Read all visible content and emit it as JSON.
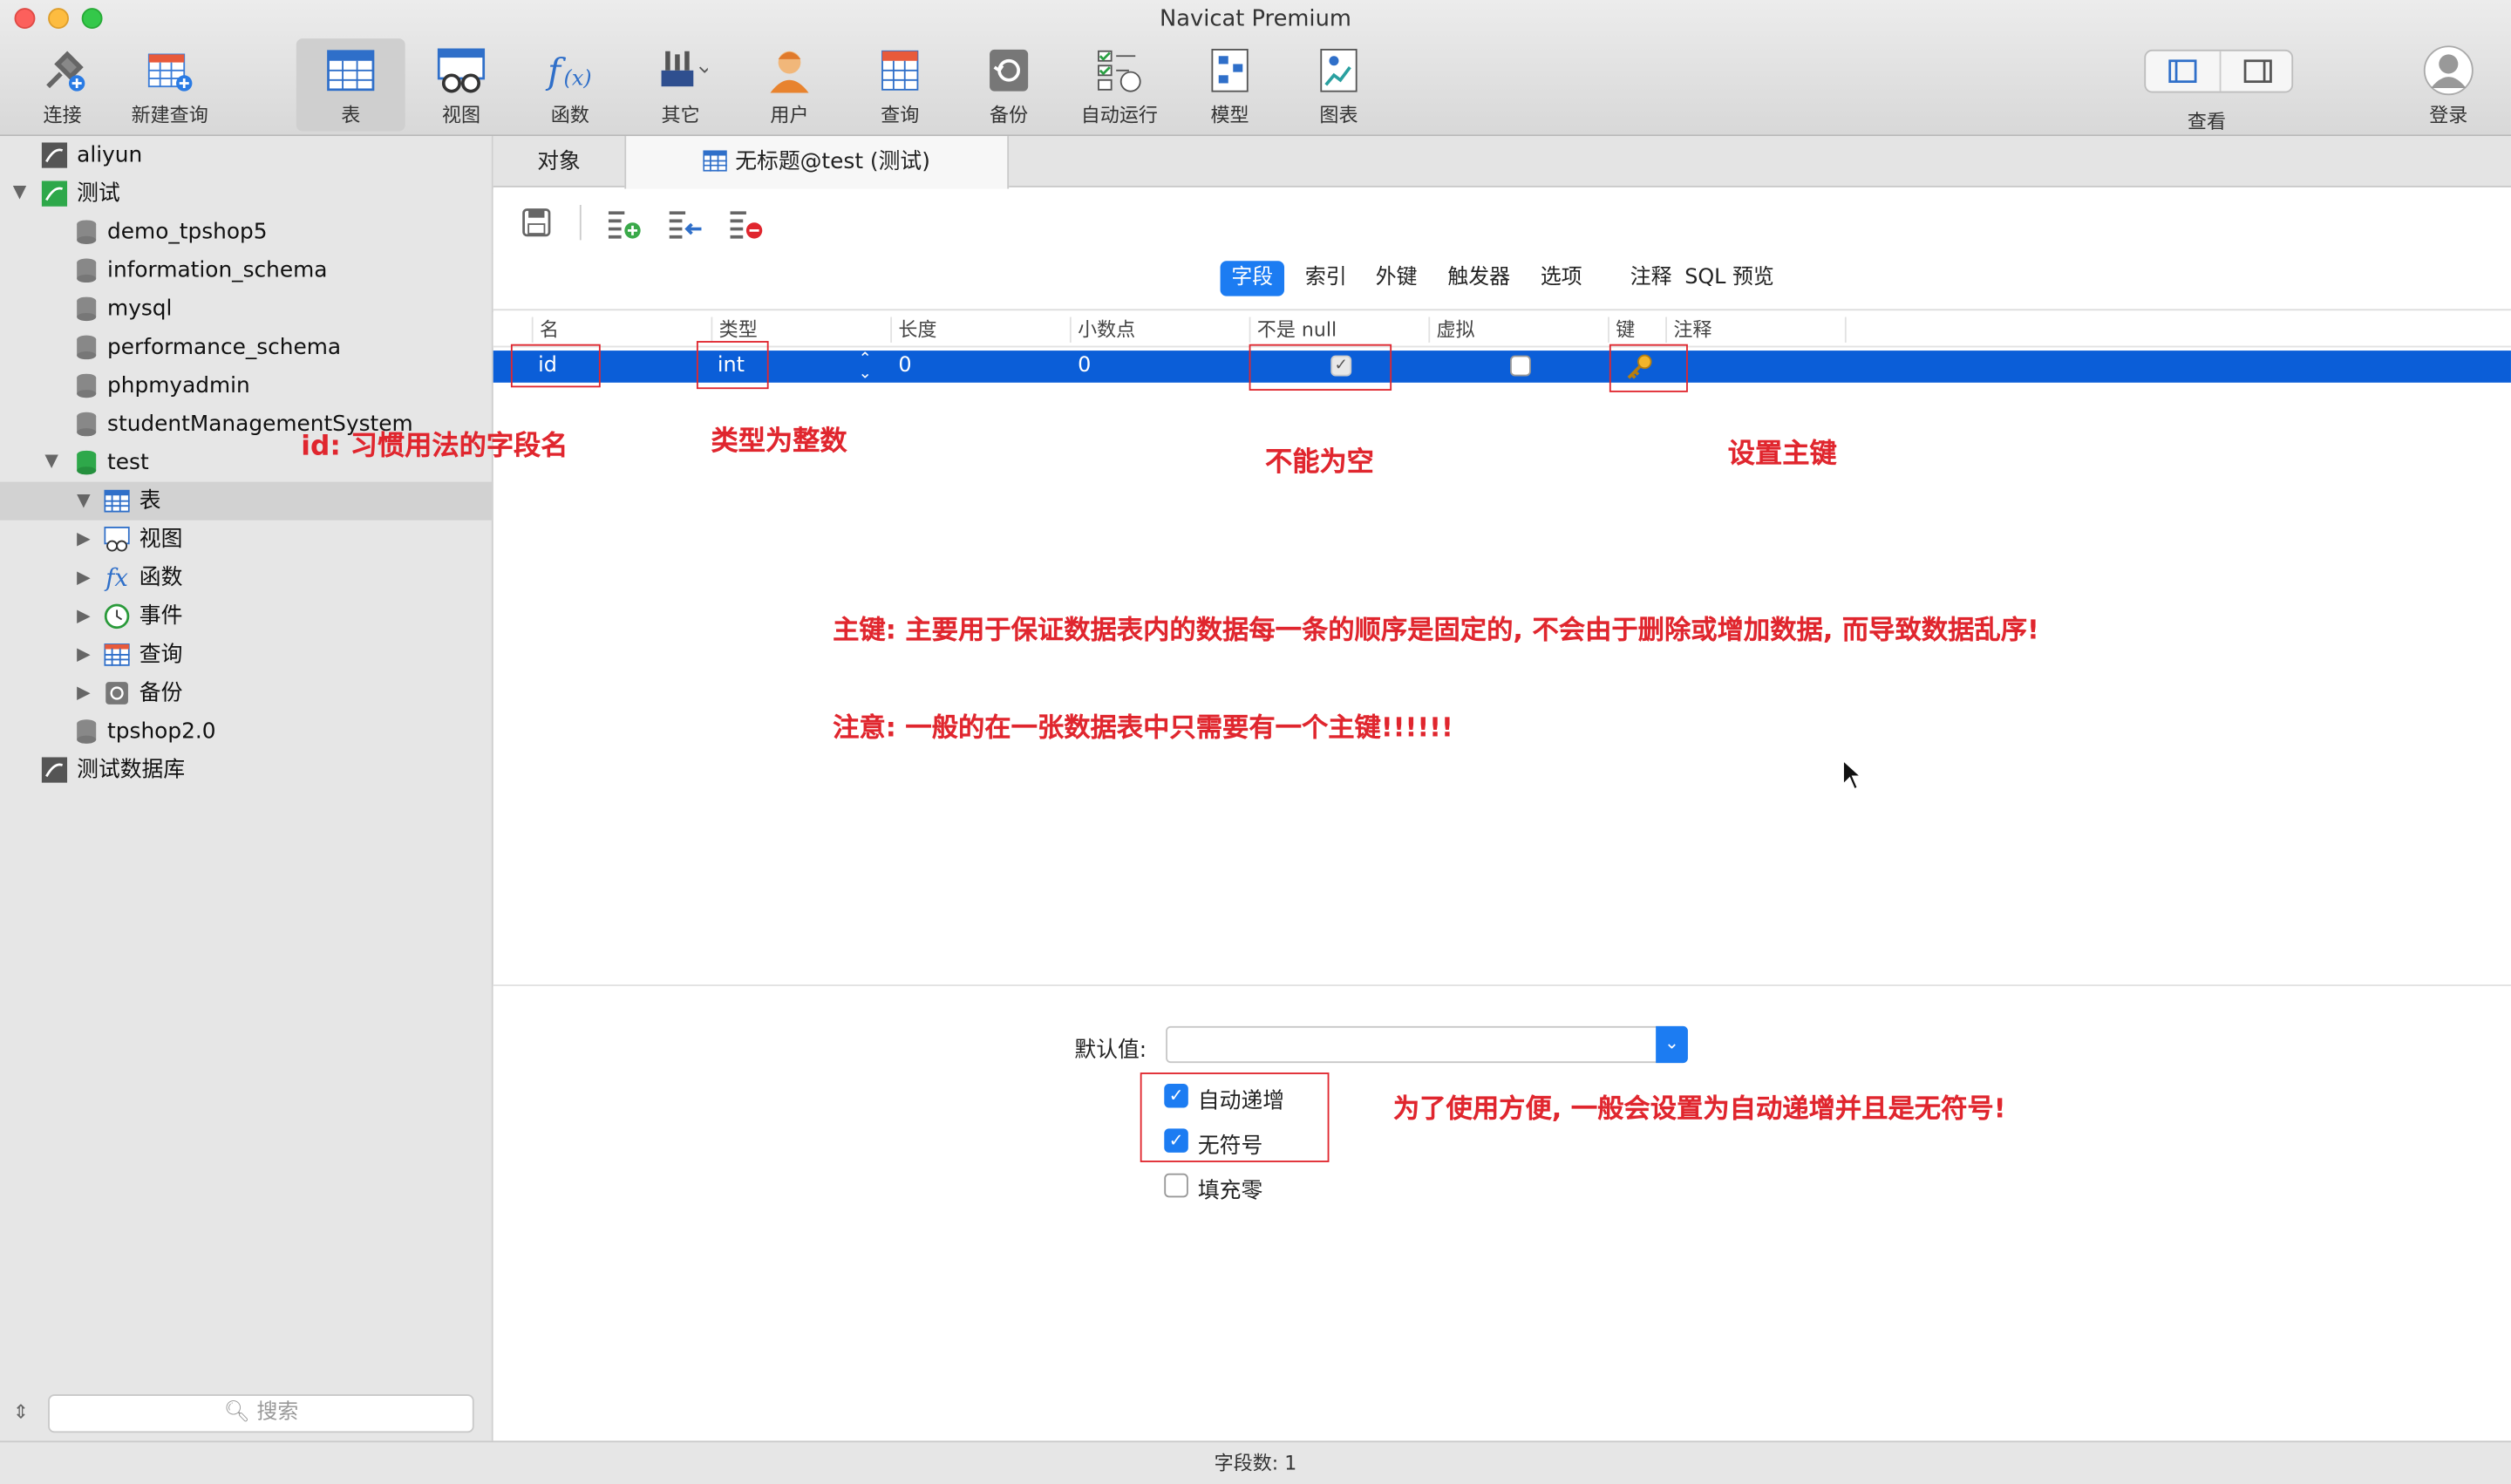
{
  "app_title": "Navicat Premium",
  "toolbar": {
    "items": [
      {
        "label": "连接"
      },
      {
        "label": "新建查询"
      },
      {
        "label": "表"
      },
      {
        "label": "视图"
      },
      {
        "label": "函数"
      },
      {
        "label": "其它"
      },
      {
        "label": "用户"
      },
      {
        "label": "查询"
      },
      {
        "label": "备份"
      },
      {
        "label": "自动运行"
      },
      {
        "label": "模型"
      },
      {
        "label": "图表"
      }
    ],
    "view_label": "查看",
    "login_label": "登录"
  },
  "sidebar": {
    "items": [
      {
        "label": "aliyun"
      },
      {
        "label": "测试"
      },
      {
        "label": "demo_tpshop5"
      },
      {
        "label": "information_schema"
      },
      {
        "label": "mysql"
      },
      {
        "label": "performance_schema"
      },
      {
        "label": "phpmyadmin"
      },
      {
        "label": "studentManagementSystem"
      },
      {
        "label": "test"
      },
      {
        "label": "表"
      },
      {
        "label": "视图"
      },
      {
        "label": "函数"
      },
      {
        "label": "事件"
      },
      {
        "label": "查询"
      },
      {
        "label": "备份"
      },
      {
        "label": "tpshop2.0"
      },
      {
        "label": "测试数据库"
      }
    ],
    "search_placeholder": "搜索"
  },
  "tabs": [
    {
      "label": "对象"
    },
    {
      "label": "无标题@test (测试)"
    }
  ],
  "subtabs": [
    {
      "label": "字段"
    },
    {
      "label": "索引"
    },
    {
      "label": "外键"
    },
    {
      "label": "触发器"
    },
    {
      "label": "选项"
    },
    {
      "label": "注释"
    },
    {
      "label": "SQL 预览"
    }
  ],
  "grid": {
    "headers": [
      "名",
      "类型",
      "长度",
      "小数点",
      "不是 null",
      "虚拟",
      "键",
      "注释"
    ],
    "row": {
      "name": "id",
      "type": "int",
      "length": "0",
      "decimals": "0",
      "not_null": true,
      "virtual": false,
      "key": "primary-key-icon"
    }
  },
  "annotations": {
    "a1": "id: 习惯用法的字段名",
    "a2": "类型为整数",
    "a3": "不能为空",
    "a4": "设置主键",
    "a5": "主键: 主要用于保证数据表内的数据每一条的顺序是固定的, 不会由于删除或增加数据, 而导致数据乱序!",
    "a6": "注意: 一般的在一张数据表中只需要有一个主键!!!!!!",
    "a7": "为了使用方便, 一般会设置为自动递增并且是无符号!"
  },
  "bottom": {
    "default_label": "默认值:",
    "default_value": "",
    "options": [
      {
        "label": "自动递增",
        "checked": true
      },
      {
        "label": "无符号",
        "checked": true
      },
      {
        "label": "填充零",
        "checked": false
      }
    ]
  },
  "status": "字段数: 1",
  "colors": {
    "accent": "#1c7cf2",
    "selection": "#0b5ed8",
    "annotation": "#e0262e"
  }
}
